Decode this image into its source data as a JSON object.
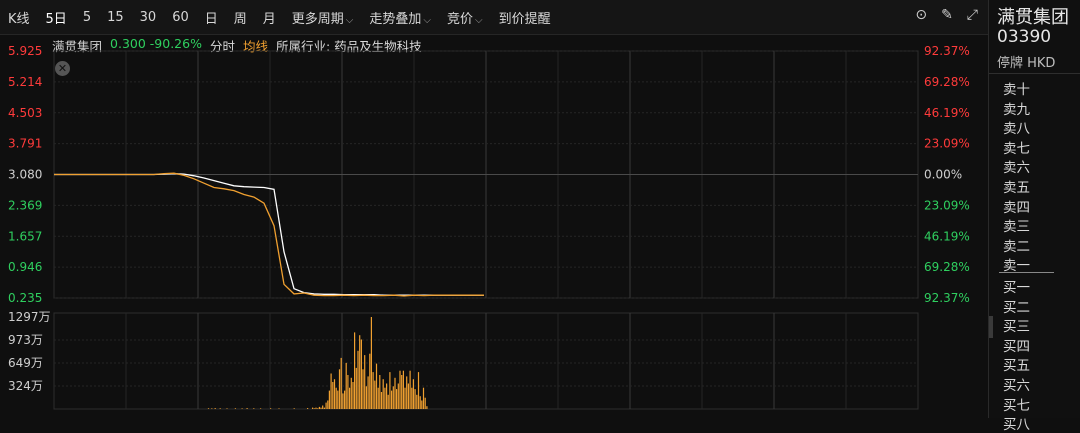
{
  "toolbar": {
    "items": [
      "K线",
      "5日",
      "5",
      "15",
      "30",
      "60",
      "日",
      "周",
      "月"
    ],
    "dropdowns": [
      "更多周期",
      "走势叠加",
      "竞价"
    ],
    "alert": "到价提醒"
  },
  "info": {
    "name": "满贯集团",
    "price": "0.300 -90.26%",
    "fenshi": "分时",
    "junxian": "均线",
    "industry": "所属行业: 药品及生物科技"
  },
  "side": {
    "name": "满贯集团",
    "code": "03390",
    "status": "停牌 HKD",
    "sell": [
      "卖十",
      "卖九",
      "卖八",
      "卖七",
      "卖六",
      "卖五",
      "卖四",
      "卖三",
      "卖二",
      "卖一"
    ],
    "buy": [
      "买一",
      "买二",
      "买三",
      "买四",
      "买五",
      "买六",
      "买七",
      "买八"
    ]
  },
  "colors": {
    "up": "#ff3b3b",
    "down": "#2fcf5f",
    "price_line": "#ffffff",
    "avg_line": "#f0a030",
    "volume": "#f0a030"
  },
  "chart_data": [
    {
      "type": "line",
      "y_ticks_left": [
        "5.925",
        "5.214",
        "4.503",
        "3.791",
        "3.080",
        "2.369",
        "1.657",
        "0.946",
        "0.235"
      ],
      "y_ticks_right": [
        "92.37%",
        "69.28%",
        "46.19%",
        "23.09%",
        "0.00%",
        "23.09%",
        "46.19%",
        "69.28%",
        "92.37%"
      ],
      "ylim": [
        0.235,
        5.925
      ],
      "x": [
        0,
        10,
        20,
        30,
        40,
        42,
        45,
        47,
        50,
        53,
        55,
        57,
        60,
        63,
        65,
        67,
        70,
        73,
        75,
        77,
        80,
        85,
        90,
        100,
        110,
        120,
        130,
        140,
        150,
        160,
        170,
        180,
        190,
        200,
        210,
        220,
        230,
        240,
        250,
        260,
        270,
        280,
        290,
        300,
        310,
        320,
        330,
        340,
        350,
        360,
        370,
        380,
        390,
        400,
        410,
        420,
        430
      ],
      "series": [
        {
          "values": [
            3.08,
            3.08,
            3.08,
            3.08,
            3.08,
            3.08,
            3.08,
            3.08,
            3.08,
            3.08,
            3.08,
            3.08,
            3.08,
            3.08,
            3.08,
            3.08,
            3.08,
            3.08,
            3.08,
            3.08,
            3.08,
            3.08,
            3.08,
            3.08,
            3.1,
            3.11,
            3.06,
            2.98,
            2.88,
            2.78,
            2.75,
            2.71,
            2.62,
            2.56,
            2.42,
            1.9,
            0.55,
            0.33,
            0.35,
            0.3,
            0.29,
            0.29,
            0.3,
            0.29,
            0.3,
            0.29,
            0.29,
            0.3,
            0.28,
            0.3,
            0.29,
            0.3,
            0.3,
            0.3,
            0.3,
            0.3,
            0.3
          ]
        },
        {
          "values": [
            3.08,
            3.08,
            3.08,
            3.08,
            3.08,
            3.08,
            3.08,
            3.08,
            3.08,
            3.08,
            3.08,
            3.08,
            3.08,
            3.08,
            3.08,
            3.08,
            3.08,
            3.08,
            3.08,
            3.08,
            3.08,
            3.08,
            3.08,
            3.08,
            3.09,
            3.1,
            3.09,
            3.05,
            3.0,
            2.94,
            2.88,
            2.82,
            2.8,
            2.79,
            2.78,
            2.74,
            1.3,
            0.45,
            0.36,
            0.33,
            0.32,
            0.32,
            0.31,
            0.31,
            0.31,
            0.31,
            0.3,
            0.3,
            0.3,
            0.3,
            0.3,
            0.3,
            0.3,
            0.3,
            0.3,
            0.3,
            0.3
          ]
        }
      ]
    },
    {
      "type": "bar",
      "y_ticks": [
        "1297万",
        "973万",
        "649万",
        "324万"
      ],
      "ylim": [
        0,
        1297
      ],
      "values": [
        0,
        0,
        0,
        0,
        0,
        0,
        0,
        0,
        0,
        0,
        0,
        0,
        0,
        0,
        0,
        0,
        0,
        0,
        0,
        0,
        0,
        0,
        0,
        0,
        0,
        0,
        0,
        0,
        0,
        0,
        0,
        0,
        0,
        0,
        0,
        0,
        0,
        0,
        0,
        0,
        0,
        0,
        0,
        0,
        0,
        0,
        0,
        0,
        0,
        0,
        0,
        0,
        0,
        0,
        0,
        0,
        0,
        0,
        0,
        0,
        0,
        0,
        0,
        0,
        0,
        0,
        0,
        0,
        0,
        0,
        0,
        0,
        0,
        0,
        0,
        0,
        0,
        0,
        0,
        0,
        0,
        0,
        0,
        0,
        0,
        0,
        0,
        0,
        0,
        0,
        0,
        10,
        0,
        8,
        0,
        12,
        0,
        0,
        10,
        0,
        0,
        0,
        8,
        0,
        0,
        0,
        0,
        10,
        0,
        0,
        0,
        8,
        0,
        0,
        12,
        0,
        0,
        0,
        10,
        0,
        0,
        0,
        8,
        0,
        0,
        0,
        0,
        0,
        10,
        0,
        0,
        0,
        0,
        8,
        0,
        0,
        0,
        0,
        0,
        0,
        0,
        0,
        10,
        0,
        0,
        0,
        0,
        0,
        0,
        0,
        12,
        0,
        0,
        20,
        10,
        20,
        10,
        30,
        20,
        50,
        20,
        90,
        120,
        260,
        500,
        380,
        420,
        300,
        260,
        560,
        720,
        220,
        260,
        650,
        480,
        300,
        440,
        380,
        1080,
        580,
        820,
        1040,
        980,
        560,
        760,
        320,
        460,
        780,
        1297,
        520,
        400,
        640,
        300,
        480,
        240,
        420,
        300,
        360,
        200,
        520,
        260,
        320,
        440,
        280,
        360,
        540,
        480,
        540,
        300,
        460,
        360,
        540,
        300,
        420,
        280,
        200,
        520,
        180,
        120,
        300,
        160,
        40
      ]
    }
  ]
}
